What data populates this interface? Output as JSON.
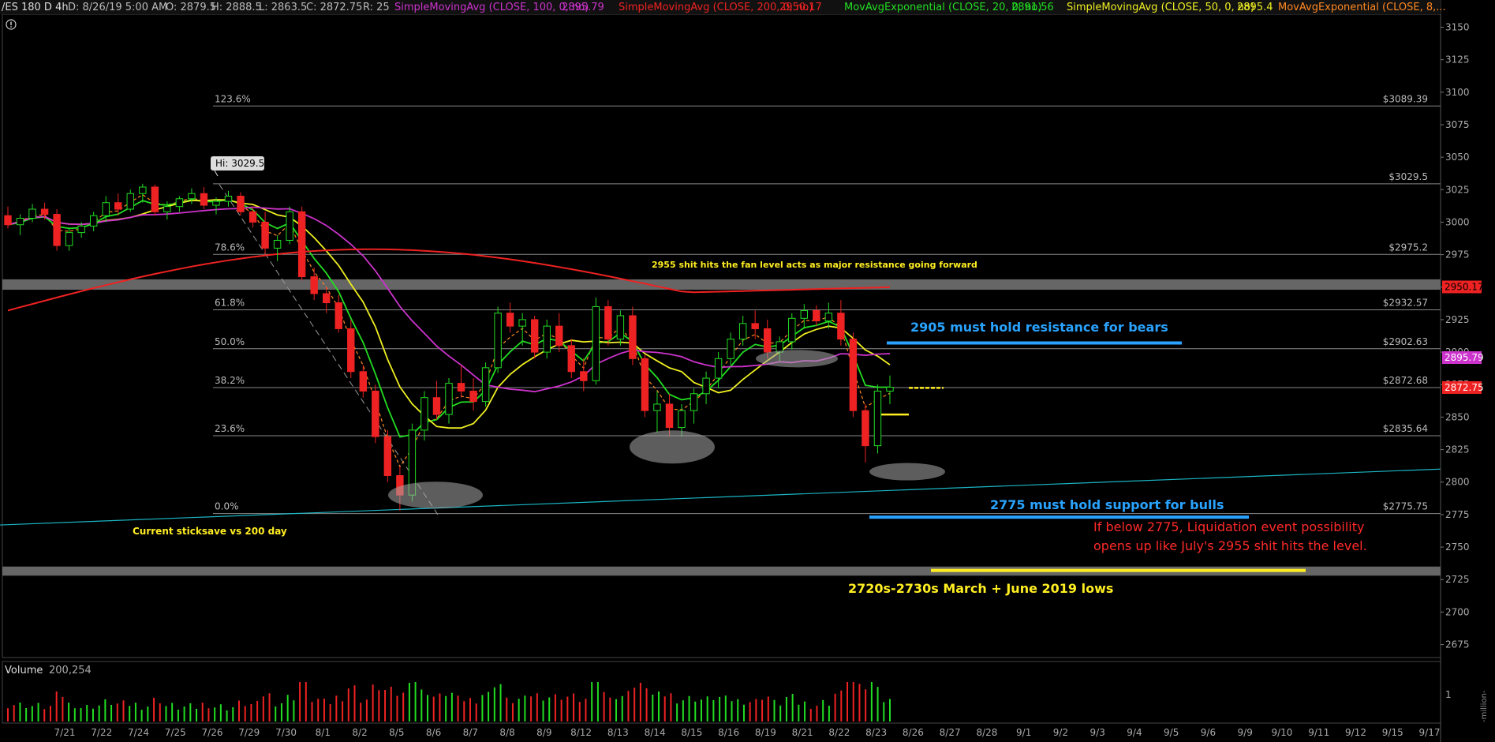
{
  "header": {
    "symbol": "/ES 180 D 4h",
    "datetime": "D: 8/26/19 5:00 AM",
    "open": "O: 2879.5",
    "high": "H: 2888.5",
    "low": "L: 2863.5",
    "close": "C: 2872.75",
    "range": "R: 25",
    "studies": [
      {
        "label": "SimpleMovingAvg (CLOSE, 100, 0, no)",
        "value": "2895.79",
        "color": "#cc33cc"
      },
      {
        "label": "SimpleMovingAvg (CLOSE, 200, 0, no)",
        "value": "2950.17",
        "color": "#ee2222"
      },
      {
        "label": "MovAvgExponential (CLOSE, 20, 0, no)",
        "value": "2891.56",
        "color": "#22dd22"
      },
      {
        "label": "SimpleMovingAvg (CLOSE, 50, 0, no)",
        "value": "2895.4",
        "color": "#eeee22"
      },
      {
        "label": "MovAvgExponential (CLOSE, 8,...",
        "value": "",
        "color": "#ff8822"
      }
    ],
    "alert_icon": "exclamation-circle-icon"
  },
  "chart_data": {
    "type": "candlestick",
    "ylim": [
      2665,
      3160
    ],
    "y_ticks": [
      3150,
      3125,
      3100,
      3075,
      3050,
      3025,
      3000,
      2975,
      2950,
      2925,
      2900,
      2875,
      2850,
      2825,
      2800,
      2775,
      2750,
      2725,
      2700,
      2675
    ],
    "x_ticks": [
      "7/21",
      "7/22",
      "7/24",
      "7/25",
      "7/26",
      "7/29",
      "7/30",
      "8/1",
      "8/2",
      "8/5",
      "8/6",
      "8/7",
      "8/8",
      "8/9",
      "8/12",
      "8/13",
      "8/14",
      "8/15",
      "8/16",
      "8/19",
      "8/21",
      "8/22",
      "8/23",
      "8/26",
      "8/27",
      "8/28",
      "9/1",
      "9/2",
      "9/3",
      "9/4",
      "9/5",
      "9/6",
      "9/9",
      "9/10",
      "9/11",
      "9/12",
      "9/15",
      "9/17"
    ],
    "high_marker": "Hi: 3029.5",
    "fib_levels": [
      {
        "pct": "123.6%",
        "price": 3089.39,
        "label": "$3089.39"
      },
      {
        "pct": "",
        "price": 3029.5,
        "label": "$3029.5"
      },
      {
        "pct": "78.6%",
        "price": 2975.2,
        "label": "$2975.2"
      },
      {
        "pct": "61.8%",
        "price": 2932.57,
        "label": "$2932.57"
      },
      {
        "pct": "50.0%",
        "price": 2902.63,
        "label": "$2902.63"
      },
      {
        "pct": "38.2%",
        "price": 2872.68,
        "label": "$2872.68"
      },
      {
        "pct": "23.6%",
        "price": 2835.64,
        "label": "$2835.64"
      },
      {
        "pct": "0.0%",
        "price": 2775.75,
        "label": "$2775.75"
      }
    ],
    "price_tags": [
      {
        "value": 2950.17,
        "label": "2950.17",
        "bg": "#ee2222",
        "fg": "#000"
      },
      {
        "value": 2895.79,
        "label": "2895.79",
        "bg": "#cc33cc",
        "fg": "#fff"
      },
      {
        "value": 2872.75,
        "label": "2872.75",
        "bg": "#ee2222",
        "fg": "#fff"
      }
    ],
    "zones": [
      {
        "from": 2948,
        "to": 2956
      },
      {
        "from": 2728,
        "to": 2735
      }
    ],
    "annotations": [
      {
        "id": "fan-note",
        "text": "2955 shit hits the fan level acts as  major resistance going forward",
        "color": "#ffee22"
      },
      {
        "id": "bears-note",
        "text": "2905 must hold resistance for bears",
        "color": "#29a3ff"
      },
      {
        "id": "bulls-note",
        "text": "2775 must hold support for bulls",
        "color": "#29a3ff"
      },
      {
        "id": "liq-note-1",
        "text": "If below 2775, Liquidation event possibility",
        "color": "#ff2a2a"
      },
      {
        "id": "liq-note-2",
        "text": "opens up like July's 2955 shit hits the level.",
        "color": "#ff2a2a"
      },
      {
        "id": "lows-note",
        "text": "2720s-2730s March + June 2019 lows",
        "color": "#ffee22"
      },
      {
        "id": "sticksave-note",
        "text": "Current sticksave vs 200 day",
        "color": "#ffee22"
      }
    ],
    "candles": [
      [
        3005,
        3012,
        2995,
        2998
      ],
      [
        2998,
        3006,
        2990,
        3003
      ],
      [
        3003,
        3014,
        3000,
        3010
      ],
      [
        3010,
        3015,
        3002,
        3006
      ],
      [
        3006,
        3010,
        2978,
        2982
      ],
      [
        2982,
        2995,
        2978,
        2992
      ],
      [
        2992,
        3000,
        2988,
        2997
      ],
      [
        2997,
        3008,
        2993,
        3005
      ],
      [
        3005,
        3020,
        3000,
        3015
      ],
      [
        3015,
        3022,
        3005,
        3010
      ],
      [
        3010,
        3025,
        3008,
        3022
      ],
      [
        3022,
        3029.5,
        3015,
        3027
      ],
      [
        3027,
        3029,
        3005,
        3008
      ],
      [
        3008,
        3016,
        3002,
        3012
      ],
      [
        3012,
        3020,
        3008,
        3018
      ],
      [
        3018,
        3026,
        3014,
        3022
      ],
      [
        3022,
        3027,
        3010,
        3013
      ],
      [
        3013,
        3019,
        3006,
        3016
      ],
      [
        3016,
        3024,
        3012,
        3020
      ],
      [
        3020,
        3023,
        3005,
        3008
      ],
      [
        3008,
        3012,
        2996,
        3000
      ],
      [
        3000,
        3008,
        2975,
        2980
      ],
      [
        2980,
        2990,
        2970,
        2986
      ],
      [
        2986,
        3012,
        2983,
        3008
      ],
      [
        3008,
        3012,
        2955,
        2958
      ],
      [
        2958,
        2965,
        2940,
        2945
      ],
      [
        2945,
        2950,
        2930,
        2938
      ],
      [
        2938,
        2944,
        2915,
        2918
      ],
      [
        2918,
        2925,
        2880,
        2885
      ],
      [
        2885,
        2890,
        2865,
        2870
      ],
      [
        2870,
        2875,
        2830,
        2835
      ],
      [
        2835,
        2840,
        2800,
        2805
      ],
      [
        2805,
        2812,
        2778,
        2790
      ],
      [
        2790,
        2845,
        2785,
        2840
      ],
      [
        2840,
        2870,
        2832,
        2865
      ],
      [
        2865,
        2878,
        2848,
        2852
      ],
      [
        2852,
        2880,
        2845,
        2876
      ],
      [
        2876,
        2890,
        2865,
        2870
      ],
      [
        2870,
        2880,
        2855,
        2862
      ],
      [
        2862,
        2892,
        2858,
        2888
      ],
      [
        2888,
        2935,
        2884,
        2930
      ],
      [
        2930,
        2938,
        2915,
        2920
      ],
      [
        2920,
        2930,
        2905,
        2925
      ],
      [
        2925,
        2928,
        2895,
        2900
      ],
      [
        2900,
        2925,
        2895,
        2920
      ],
      [
        2920,
        2930,
        2900,
        2905
      ],
      [
        2905,
        2910,
        2880,
        2885
      ],
      [
        2885,
        2895,
        2870,
        2878
      ],
      [
        2878,
        2942,
        2875,
        2935
      ],
      [
        2935,
        2940,
        2905,
        2910
      ],
      [
        2910,
        2932,
        2905,
        2928
      ],
      [
        2928,
        2935,
        2890,
        2895
      ],
      [
        2895,
        2898,
        2850,
        2855
      ],
      [
        2855,
        2870,
        2838,
        2860
      ],
      [
        2860,
        2868,
        2835,
        2842
      ],
      [
        2842,
        2860,
        2835,
        2855
      ],
      [
        2855,
        2872,
        2845,
        2868
      ],
      [
        2868,
        2885,
        2860,
        2880
      ],
      [
        2880,
        2900,
        2872,
        2895
      ],
      [
        2895,
        2915,
        2890,
        2910
      ],
      [
        2910,
        2928,
        2905,
        2922
      ],
      [
        2922,
        2932,
        2910,
        2918
      ],
      [
        2918,
        2925,
        2895,
        2900
      ],
      [
        2900,
        2912,
        2893,
        2908
      ],
      [
        2908,
        2930,
        2902,
        2926
      ],
      [
        2926,
        2937,
        2918,
        2932
      ],
      [
        2932,
        2936,
        2920,
        2924
      ],
      [
        2924,
        2938,
        2918,
        2930
      ],
      [
        2930,
        2940,
        2905,
        2910
      ],
      [
        2910,
        2915,
        2850,
        2855
      ],
      [
        2855,
        2860,
        2815,
        2828
      ],
      [
        2828,
        2875,
        2822,
        2870
      ],
      [
        2870,
        2882,
        2860,
        2873
      ]
    ]
  },
  "volume_panel": {
    "title": "Volume",
    "value": "200,254",
    "axis_label": "1",
    "unit_label": "-million-"
  }
}
